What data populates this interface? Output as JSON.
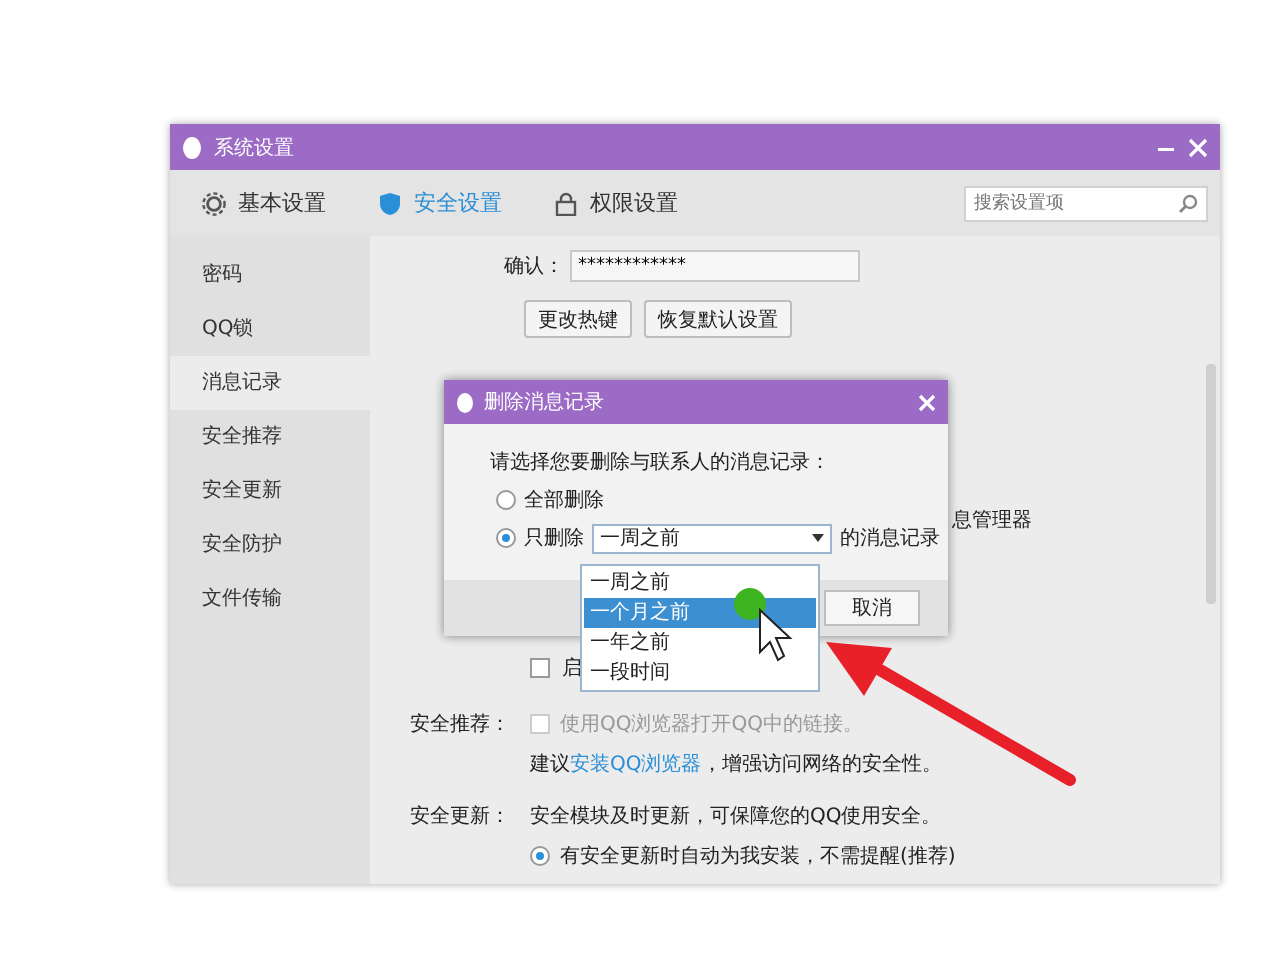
{
  "window": {
    "title": "系统设置"
  },
  "tabs": [
    {
      "label": "基本设置",
      "kind": "gear",
      "selected": false
    },
    {
      "label": "安全设置",
      "kind": "shield",
      "selected": true
    },
    {
      "label": "权限设置",
      "kind": "lock",
      "selected": false
    }
  ],
  "search": {
    "placeholder": "搜索设置项"
  },
  "sidebar": {
    "items": [
      {
        "label": "密码",
        "selected": false
      },
      {
        "label": "QQ锁",
        "selected": false
      },
      {
        "label": "消息记录",
        "selected": true
      },
      {
        "label": "安全推荐",
        "selected": false
      },
      {
        "label": "安全更新",
        "selected": false
      },
      {
        "label": "安全防护",
        "selected": false
      },
      {
        "label": "文件传输",
        "selected": false
      }
    ]
  },
  "password": {
    "label": "确认：",
    "value": "************"
  },
  "buttons": [
    "更改热键",
    "恢复默认设置"
  ],
  "message_section": {
    "fragment": "息管理器",
    "checkboxes": [
      {
        "label": "启",
        "checked": false
      }
    ]
  },
  "security_recommend": {
    "label": "安全推荐：",
    "option": {
      "text": "使用QQ浏览器打开QQ中的链接。",
      "checked": false,
      "disabled": true
    },
    "note": {
      "before": "建议",
      "link": "安装QQ浏览器",
      "after": "，增强访问网络的安全性。"
    }
  },
  "security_update": {
    "label": "安全更新：",
    "text": "安全模块及时更新，可保障您的QQ使用安全。",
    "option": {
      "text": "有安全更新时自动为我安装，不需提醒(推荐)",
      "selected": true
    }
  },
  "dialog": {
    "title": "删除消息记录",
    "prompt": "请选择您要删除与联系人的消息记录：",
    "options": [
      {
        "label": "全部删除",
        "selected": false
      },
      {
        "label": "只删除",
        "selected": true
      }
    ],
    "combo": {
      "value": "一周之前"
    },
    "suffix": "的消息记录",
    "cancel": "取消",
    "dropdown": [
      {
        "label": "一周之前",
        "selected": false
      },
      {
        "label": "一个月之前",
        "selected": true
      },
      {
        "label": "一年之前",
        "selected": false
      },
      {
        "label": "一段时间",
        "selected": false
      }
    ]
  }
}
